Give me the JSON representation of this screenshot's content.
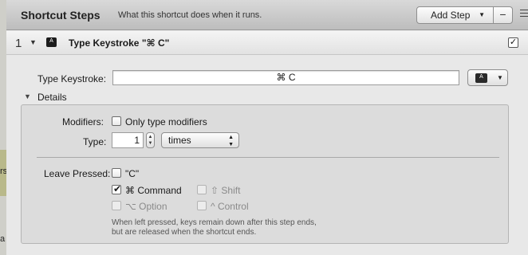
{
  "header": {
    "title": "Shortcut Steps",
    "subtitle": "What this shortcut does when it runs.",
    "add_step_label": "Add Step",
    "minus_label": "−"
  },
  "step": {
    "number": "1",
    "title": "Type Keystroke \"⌘ C\"",
    "enabled": true
  },
  "type_keystroke": {
    "label": "Type Keystroke:",
    "value": "⌘ C"
  },
  "details": {
    "label": "Details",
    "modifiers_label": "Modifiers:",
    "only_modifiers_label": "Only type modifiers",
    "type_label": "Type:",
    "type_count": "1",
    "type_unit": "times",
    "leave_pressed_label": "Leave Pressed:",
    "options": {
      "c": "\"C\"",
      "command": "⌘ Command",
      "shift": "⇧ Shift",
      "option": "⌥ Option",
      "control": "^ Control"
    },
    "note_line1": "When left pressed, keys remain down after this step ends,",
    "note_line2": "but are released when the shortcut ends."
  },
  "background_fragments": {
    "a": "rs",
    "b": "a"
  }
}
